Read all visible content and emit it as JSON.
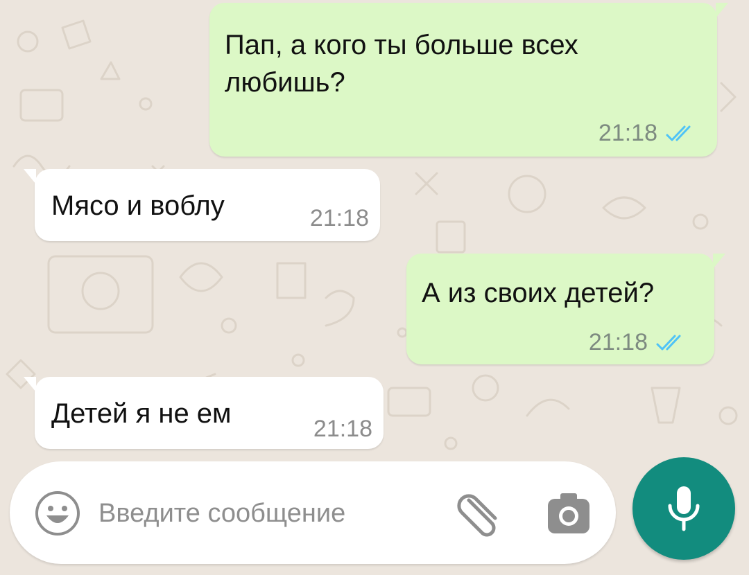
{
  "theme": {
    "wallpaper": "#ECE5DD",
    "outgoing_bubble": "#DCF8C6",
    "incoming_bubble": "#FFFFFF",
    "read_tick": "#4FC3F7",
    "accent": "#128C7E"
  },
  "messages": [
    {
      "direction": "outgoing",
      "text": "Пап, а кого ты больше всех\nлюбишь?",
      "time": "21:18",
      "status": "read"
    },
    {
      "direction": "incoming",
      "text": "Мясо и воблу",
      "time": "21:18"
    },
    {
      "direction": "outgoing",
      "text": "А из своих детей?",
      "time": "21:18",
      "status": "read"
    },
    {
      "direction": "incoming",
      "text": "Детей я не ем",
      "time": "21:18"
    }
  ],
  "composer": {
    "placeholder": "Введите сообщение",
    "value": "",
    "icons": {
      "emoji": "emoji-icon",
      "attach": "paperclip-icon",
      "camera": "camera-icon",
      "mic": "microphone-icon"
    }
  }
}
